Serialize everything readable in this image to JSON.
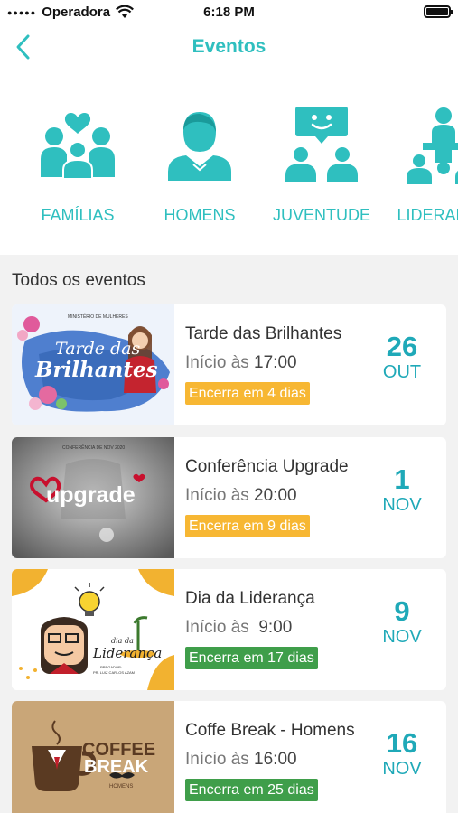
{
  "status": {
    "carrier": "Operadora",
    "time": "6:18 PM"
  },
  "nav": {
    "title": "Eventos"
  },
  "categories": [
    {
      "label": "FAMÍLIAS",
      "icon": "family-icon"
    },
    {
      "label": "HOMENS",
      "icon": "man-icon"
    },
    {
      "label": "JUVENTUDE",
      "icon": "youth-chat-icon"
    },
    {
      "label": "LIDERANÇA",
      "icon": "leadership-podium-icon"
    }
  ],
  "section_title": "Todos os eventos",
  "events": [
    {
      "name": "Tarde das Brilhantes",
      "start_label": "Início às",
      "start_time": "17:00",
      "badge": "Encerra em 4 dias",
      "badge_color": "#f7b733",
      "day": "26",
      "month": "OUT",
      "thumb": {
        "org": "MINISTÉRIO DE MULHERES",
        "line1": "Tarde das",
        "line2": "Brilhantes"
      }
    },
    {
      "name": "Conferência Upgrade",
      "start_label": "Início às",
      "start_time": "20:00",
      "badge": "Encerra em 9 dias",
      "badge_color": "#f7b733",
      "day": "1",
      "month": "NOV",
      "thumb": {
        "org": "CONFERÊNCIA DE NOV 2020",
        "word": "upgrade"
      }
    },
    {
      "name": "Dia da Liderança",
      "start_label": "Início às",
      "start_time": " 9:00",
      "badge": "Encerra em 17 dias",
      "badge_color": "#3f9e4a",
      "day": "9",
      "month": "NOV",
      "thumb": {
        "line1": "dia da",
        "line2": "Liderança",
        "sub1": "PREGADOR:",
        "sub2": "PR. LUIZ CARLOS AZAM"
      }
    },
    {
      "name": "Coffe Break - Homens",
      "start_label": "Início às",
      "start_time": "16:00",
      "badge": "Encerra em 25 dias",
      "badge_color": "#3f9e4a",
      "day": "16",
      "month": "NOV",
      "thumb": {
        "line1": "COFFEE",
        "line2": "BREAK",
        "sub": "HOMENS"
      }
    }
  ],
  "colors": {
    "accent": "#2fbfbf",
    "date": "#1fa9b8",
    "warning": "#f7b733",
    "ok": "#3f9e4a"
  }
}
